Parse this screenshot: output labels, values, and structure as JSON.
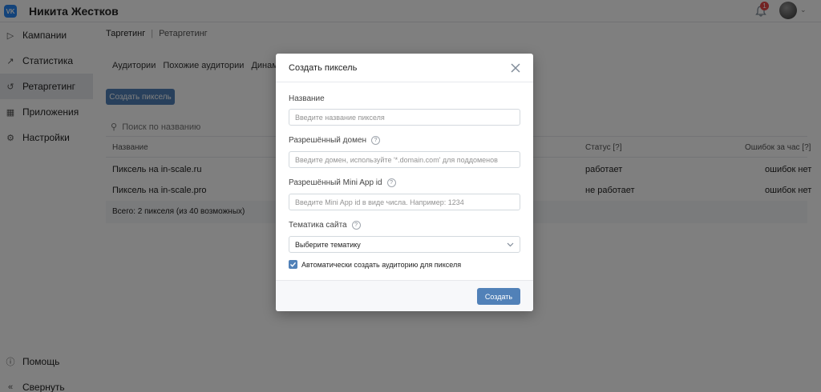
{
  "topbar": {
    "logo_text": "VK",
    "account_name": "Никита Жестков",
    "notifications_count": "1"
  },
  "sidebar": {
    "items": [
      {
        "label": "Кампании",
        "icon": "megaphone-icon"
      },
      {
        "label": "Статистика",
        "icon": "chart-icon"
      },
      {
        "label": "Ретаргетинг",
        "icon": "retarget-icon",
        "active": true
      },
      {
        "label": "Приложения",
        "icon": "apps-icon"
      },
      {
        "label": "Настройки",
        "icon": "gear-icon"
      }
    ],
    "bottom": [
      {
        "label": "Помощь",
        "icon": "help-icon"
      },
      {
        "label": "Свернуть",
        "icon": "collapse-icon"
      }
    ]
  },
  "content": {
    "breadcrumb": [
      "Таргетинг",
      "Ретаргетинг"
    ],
    "subtabs": [
      "Аудитории",
      "Похожие аудитории",
      "Динамически"
    ],
    "create_pixel_button": "Создать пиксель",
    "search_placeholder": "Поиск по названию",
    "table": {
      "headers": [
        "Название",
        "Статус [?]",
        "Ошибок за час [?]"
      ],
      "rows": [
        {
          "name": "Пиксель на in-scale.ru",
          "status": "работает",
          "errors": "ошибок нет"
        },
        {
          "name": "Пиксель на in-scale.pro",
          "status": "не работает",
          "errors": "ошибок нет"
        }
      ],
      "total": "Всего: 2 пикселя (из 40 возможных)"
    }
  },
  "modal": {
    "title": "Создать пиксель",
    "name_label": "Название",
    "name_placeholder": "Введите название пикселя",
    "domain_label": "Разрешённый домен",
    "domain_placeholder": "Введите домен, используйте '*.domain.com' для поддоменов",
    "miniapp_label": "Разрешённый Mini App id",
    "miniapp_placeholder": "Введите Mini App id в виде числа. Например: 1234",
    "theme_label": "Тематика сайта",
    "theme_value": "Выберите тематику",
    "auto_audience_label": "Автоматически создать аудиторию для пикселя",
    "auto_audience_checked": true,
    "submit_label": "Создать",
    "help_glyph": "?"
  },
  "colors": {
    "accent": "#5181b8",
    "vk_logo": "#2787f5",
    "badge": "#e64646"
  }
}
